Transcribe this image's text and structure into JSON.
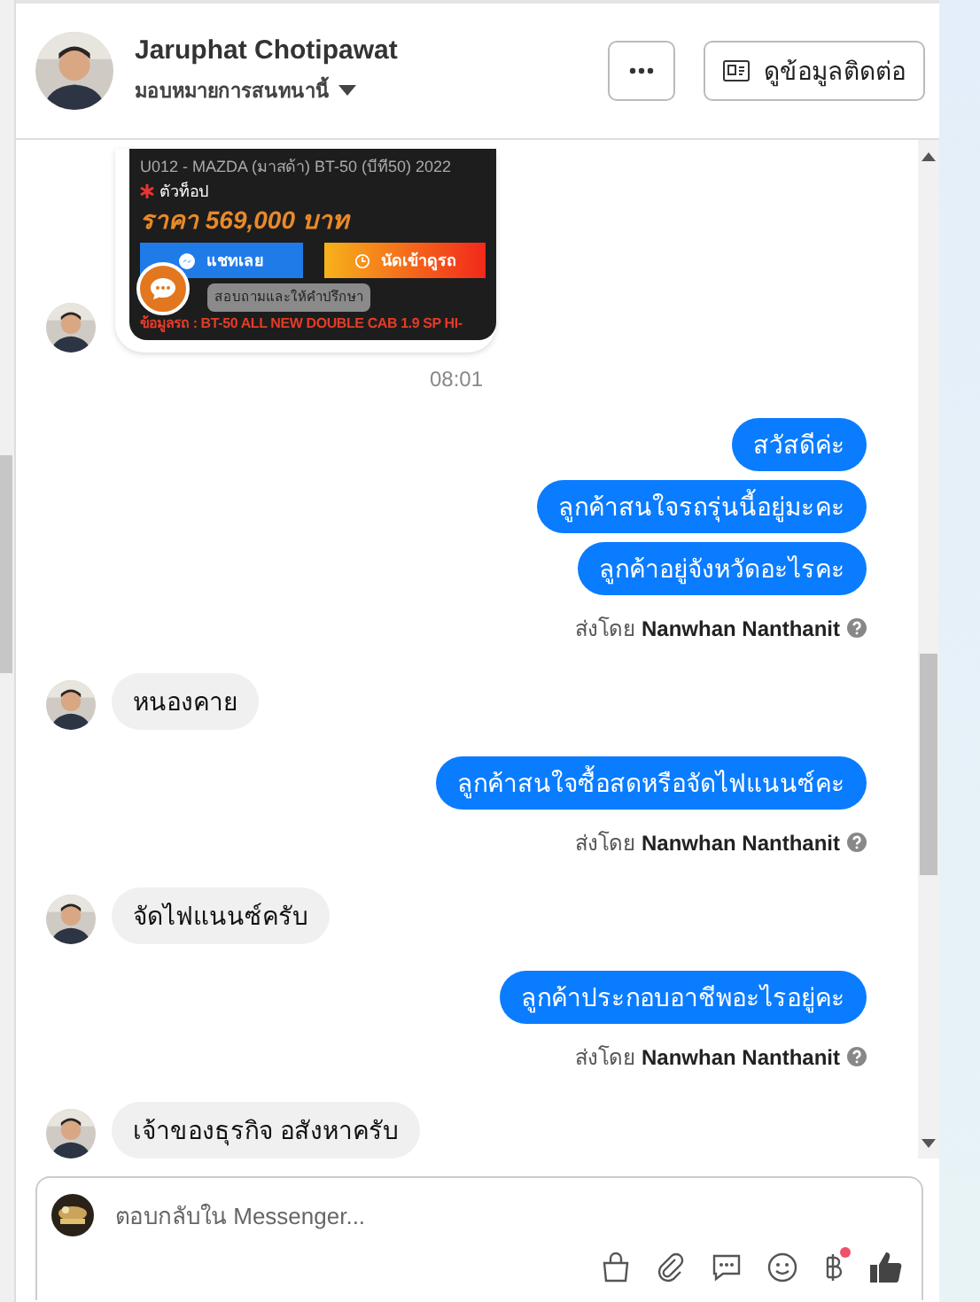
{
  "header": {
    "name": "Jaruphat Chotipawat",
    "subtitle": "มอบหมายการสนทนานี้",
    "contact_button": "ดูข้อมูลติดต่อ"
  },
  "messages": [
    {
      "kind": "listing",
      "title": "U012 - MAZDA (มาสด้า) BT-50 (บีที50) 2022",
      "tag": "ตัวท็อป",
      "price": "ราคา 569,000 บาท",
      "chat_button": "แชทเลย",
      "visit_button": "นัดเข้าดูรถ",
      "tooltip": "สอบถามและให้คำปรึกษา",
      "details": "ข้อมูลรถ : BT-50 ALL NEW DOUBLE CAB 1.9 SP HI-"
    },
    {
      "kind": "time",
      "text": "08:01"
    },
    {
      "kind": "outgoing",
      "text": "สวัสดีค่ะ"
    },
    {
      "kind": "outgoing",
      "text": "ลูกค้าสนใจรถรุ่นนี้อยู่มะคะ"
    },
    {
      "kind": "outgoing",
      "text": "ลูกค้าอยู่จังหวัดอะไรคะ"
    },
    {
      "kind": "sent_by",
      "prefix": "ส่งโดย",
      "name": "Nanwhan Nanthanit"
    },
    {
      "kind": "incoming",
      "text": "หนองคาย"
    },
    {
      "kind": "outgoing",
      "text": "ลูกค้าสนใจซื้อสดหรือจัดไฟแนนซ์คะ"
    },
    {
      "kind": "sent_by",
      "prefix": "ส่งโดย",
      "name": "Nanwhan Nanthanit"
    },
    {
      "kind": "incoming",
      "text": "จัดไฟแนนซ์ครับ"
    },
    {
      "kind": "outgoing",
      "text": "ลูกค้าประกอบอาชีพอะไรอยู่คะ"
    },
    {
      "kind": "sent_by",
      "prefix": "ส่งโดย",
      "name": "Nanwhan Nanthanit"
    },
    {
      "kind": "incoming",
      "text": "เจ้าของธุรกิจ อสังหาครับ"
    }
  ],
  "composer": {
    "placeholder": "ตอบกลับใน Messenger...",
    "notification_dot": true
  }
}
